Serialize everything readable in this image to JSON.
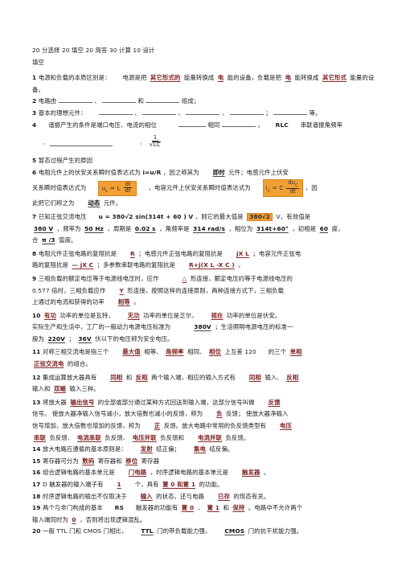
{
  "document": {
    "header": {
      "score_line": "20 分选择 20 填空 20 简答 30 计算 10 设计",
      "section_title": "填空"
    },
    "highlight_color": "#F2A033",
    "answer_color": "#7a1f1f",
    "questions": [
      {
        "num": "1",
        "prefix": "电源和负载的本质区别是：",
        "seg_a": "电源是把",
        "ans_1": "其它形式的",
        "seg_b": "能量转换成",
        "ans_2": "电",
        "seg_c": "能的设备，负载是把",
        "ans_3": "电",
        "seg_d": "能转换成",
        "ans_4": "其它形式",
        "seg_e": "能量的设备。"
      },
      {
        "num": "2",
        "text_a": "电路由",
        "text_b": "、",
        "text_c": "和",
        "text_d": "组成；"
      },
      {
        "num": "3",
        "text_a": "基本的理想元件：",
        "text_b": "、",
        "text_c": "、",
        "text_d": "、",
        "text_e": "；",
        "text_f": "等。"
      },
      {
        "num": "4",
        "text_a": "谐振产生的条件是端口电压、电流的相位",
        "text_b": "相同",
        "text_c": "，",
        "text_d": "RLC",
        "text_e": "串联谐振角频率"
      },
      {
        "num": "5",
        "text": "暂态过程产生的原因"
      },
      {
        "num": "6",
        "seg_a": "电阻元件上的伏安关系瞬时值表达式为",
        "expr_a": "i=u/R",
        "seg_b": "，因之称其为",
        "ans_1": "即时",
        "seg_c": "元件；电感元件上伏安",
        "seg_d": "关系瞬时值表达式为",
        "formula_1": {
          "lhs": "u",
          "lhs_sub": "L",
          "eq": "=  L",
          "num": "di",
          "den": "dt"
        },
        "seg_e": "，电容元件上伏安关系瞬时值表达式为",
        "formula_2": {
          "lhs": "i",
          "lhs_sub": "c",
          "eq": "=  C",
          "num": "du",
          "num_sub": "c",
          "den": "dt"
        },
        "seg_f": "，因",
        "seg_g": "此把它们称之为",
        "ans_2": "动态",
        "seg_h": "元件。"
      },
      {
        "num": "7",
        "seg_a": "已知正弦交流电压",
        "expr": "u = 380√2 sin(314t + 60 ) V",
        "seg_b": "，则它的最大值是",
        "ans_max": "380√2",
        "unit_max": "V，有效值是",
        "ans_rms": "380 V",
        "seg_c": "，频率为",
        "ans_freq": "50 Hz",
        "seg_d": "，周期是",
        "ans_period": "0.02 s",
        "seg_e": "，角频率是",
        "ans_omega": "314 rad/s",
        "seg_f": "，相位为",
        "ans_phase": "314t+60°",
        "seg_g": "，初相是",
        "ans_init": "60",
        "seg_h": "度，",
        "seg_i": "合",
        "ans_rad": "π /3",
        "seg_j": "弧度。"
      },
      {
        "num": "8",
        "seg_a": "电阻元件正弦电路的复阻抗是",
        "ans_1": "R",
        "seg_b": "；电感元件正弦电路的复阻抗是",
        "ans_2": "jX L",
        "seg_c": "；电容元件正弦电",
        "seg_d": "路的复阻抗是",
        "ans_3": "— jX C",
        "seg_e": "；多参数串联电路的复阻抗是",
        "ans_4": "R+j(X L -X C )",
        "seg_f": "。"
      },
      {
        "num": "9",
        "seg_a": "三相负载的额定电压等于电源线电压时，应作",
        "ans_1": "△",
        "seg_b": "形连接，额定电压约等于电源线电压的",
        "seg_c": "0.577 倍时，三相负载应作",
        "ans_2": "Y",
        "seg_d": "形连接。按照这样的连接原则，两种连接方式下，三相负载",
        "seg_e": "上通过的电流和获得的功率",
        "ans_3": "相等",
        "seg_f": "。"
      },
      {
        "num": "10",
        "ans_1": "有功",
        "seg_a": "功率的单位是瓦特，",
        "ans_2": "无功",
        "seg_b": "功率的单位是乏尔，",
        "ans_3": "视在",
        "seg_c": "功率的单位是伏安。",
        "seg_d": "实际生产和生活中，工厂的一般动力电源电压标准为",
        "ans_4": "380V",
        "seg_e": "；生活照明电源电压的标准一",
        "seg_f": "般为",
        "ans_5": "220V",
        "seg_g": "；",
        "ans_6": "36V",
        "seg_h": "伏以下的电压称为安全电压。"
      },
      {
        "num": "11",
        "seg_a": "对称三相交流电是指三个",
        "ans_1": "最大值",
        "seg_b": "相等、",
        "ans_2": "角频率",
        "seg_c": "相同、",
        "ans_3": "相位",
        "seg_d": "上互差 120",
        "seg_e": "的三个",
        "ans_4": "单相",
        "seg_f": "正弦交流电",
        "seg_g": "的组合。"
      },
      {
        "num": "12",
        "seg_a": "集成运算放大器具有",
        "ans_1": "同相",
        "seg_b": "和",
        "ans_2": "反相",
        "seg_c": "两个输入端，相应的输入方式有",
        "ans_3": "同相",
        "seg_d": "输入、",
        "ans_4": "反相",
        "seg_e": "输入和",
        "ans_5": "双端",
        "seg_f": "输入三种。"
      },
      {
        "num": "13",
        "seg_a": "将放大器",
        "ans_1": "输出信号",
        "seg_b": "的全部或部分通过某种方式回送到输入端，这部分信号叫做",
        "ans_2": "反馈",
        "seg_c": "信号。 使放大器净输入信号减小，放大倍数也减小的反馈，称为",
        "ans_3": "负",
        "seg_d": "反馈；  使放大器净输入",
        "seg_e": "信号增加，放大倍数也增加的反馈，称为",
        "ans_4": "正",
        "seg_f": "反馈。放大电路中常用的负反馈类型有",
        "ans_5": "电压",
        "seg_g": "串联",
        "seg_h": "负反馈、",
        "ans_6": "电流串联",
        "seg_i": "负反馈、",
        "ans_7": "电压并联",
        "seg_j": "负反馈和",
        "ans_8": "电流并联",
        "seg_k": "负反馈。"
      },
      {
        "num": "14",
        "seg_a": "放大电路应遵循的基本原则是：",
        "ans_1": "发射",
        "seg_b": "结正偏；",
        "ans_2": "集电",
        "seg_c": "结反偏。"
      },
      {
        "num": "15",
        "seg_a": "寄存器可分为",
        "ans_1": "数码",
        "seg_b": "寄存器和",
        "ans_2": "移位",
        "seg_c": "寄存器"
      },
      {
        "num": "16",
        "seg_a": "组合逻辑电路的基本单元是",
        "ans_1": "门电路",
        "seg_b": "，时序逻辑电路的基本单元是",
        "ans_2": "触发器",
        "seg_c": "。"
      },
      {
        "num": "17",
        "seg_a": "D 触发器的输入端子有",
        "ans_1": "1",
        "seg_b": "个，具有",
        "ans_2": "置 0 和置 1",
        "seg_c": "的功能。"
      },
      {
        "num": "18",
        "seg_a": "时序逻辑电路的输出不仅取决于",
        "ans_1": "输入",
        "seg_b": "的状态，还与电路",
        "ans_2": "已存",
        "seg_c": "的现态有关。"
      },
      {
        "num": "19",
        "seg_a": "两个与非门构成的基本",
        "seg_b": "RS",
        "seg_c": "触发器的功能有",
        "ans_1": "置 0",
        "seg_d": "、",
        "ans_2": "置 1",
        "seg_e": "和",
        "ans_3": "保持",
        "seg_f": "。电路中不允许两个",
        "seg_g": "输入端同时为",
        "ans_4": "0",
        "seg_h": "，否则将出现逻辑混乱。"
      },
      {
        "num": "20",
        "seg_a": "一般 TTL 门和 CMOS 门相比，",
        "ans_1": "TTL",
        "seg_b": "门的带负载能力强，",
        "ans_2": "CMOS",
        "seg_c": "门的抗干扰能力强。"
      }
    ],
    "formula_4": {
      "numerator": "1",
      "denominator": "LC",
      "radical": "√"
    }
  }
}
